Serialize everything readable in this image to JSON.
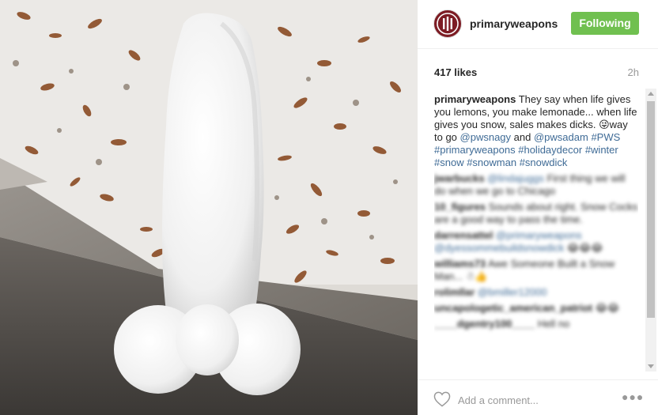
{
  "post": {
    "image_alt": "Snowman on a concrete ledge with snow and fallen autumn leaves",
    "username": "primaryweapons",
    "follow_label": "Following",
    "likes": "417 likes",
    "time": "2h"
  },
  "caption": {
    "author": "primaryweapons",
    "text1": " They say when life gives you lemons, you make lemonade... when life gives you snow, sales makes dicks. ",
    "emoji": "😜",
    "text2": "way to go ",
    "tags": [
      "@pwsnagy",
      "@pwsadam",
      "#PWS",
      "#primaryweapons",
      "#holidaydecor",
      "#winter",
      "#snow",
      "#snowman",
      "#snowdick"
    ],
    "and": " and "
  },
  "comments": [
    {
      "author": "jwarbucks",
      "tag": "@lindajuggs",
      "text": " First thing we will do when we go to Chicago"
    },
    {
      "author": "10_figures",
      "tag": "",
      "text": " Sounds about right. Snow Cocks are a good way to pass the time."
    },
    {
      "author": "darrensattel",
      "tag": "@primaryweapons @dyessommebuildsnowdick",
      "text": " 😂😂😂"
    },
    {
      "author": "williams73",
      "tag": "",
      "text": " Awe Someone Built a Snow Man... ☃👍"
    },
    {
      "author": "rolimllar",
      "tag": "@bmiller12000",
      "text": ""
    },
    {
      "author": "uncapologetic_american_patriot",
      "tag": "",
      "text": " 😂😂"
    },
    {
      "author": "____dgentry100____",
      "tag": "",
      "text": " Hell no"
    }
  ],
  "footer": {
    "add_comment_placeholder": "Add a comment...",
    "more_label": "●●●"
  },
  "icons": {
    "avatar": "primary-weapons-logo-icon",
    "like": "heart-outline-icon",
    "more": "more-options-icon"
  },
  "colors": {
    "follow_button": "#70c050",
    "hashtag": "#3f6b96",
    "avatar": "#7d1c24"
  }
}
